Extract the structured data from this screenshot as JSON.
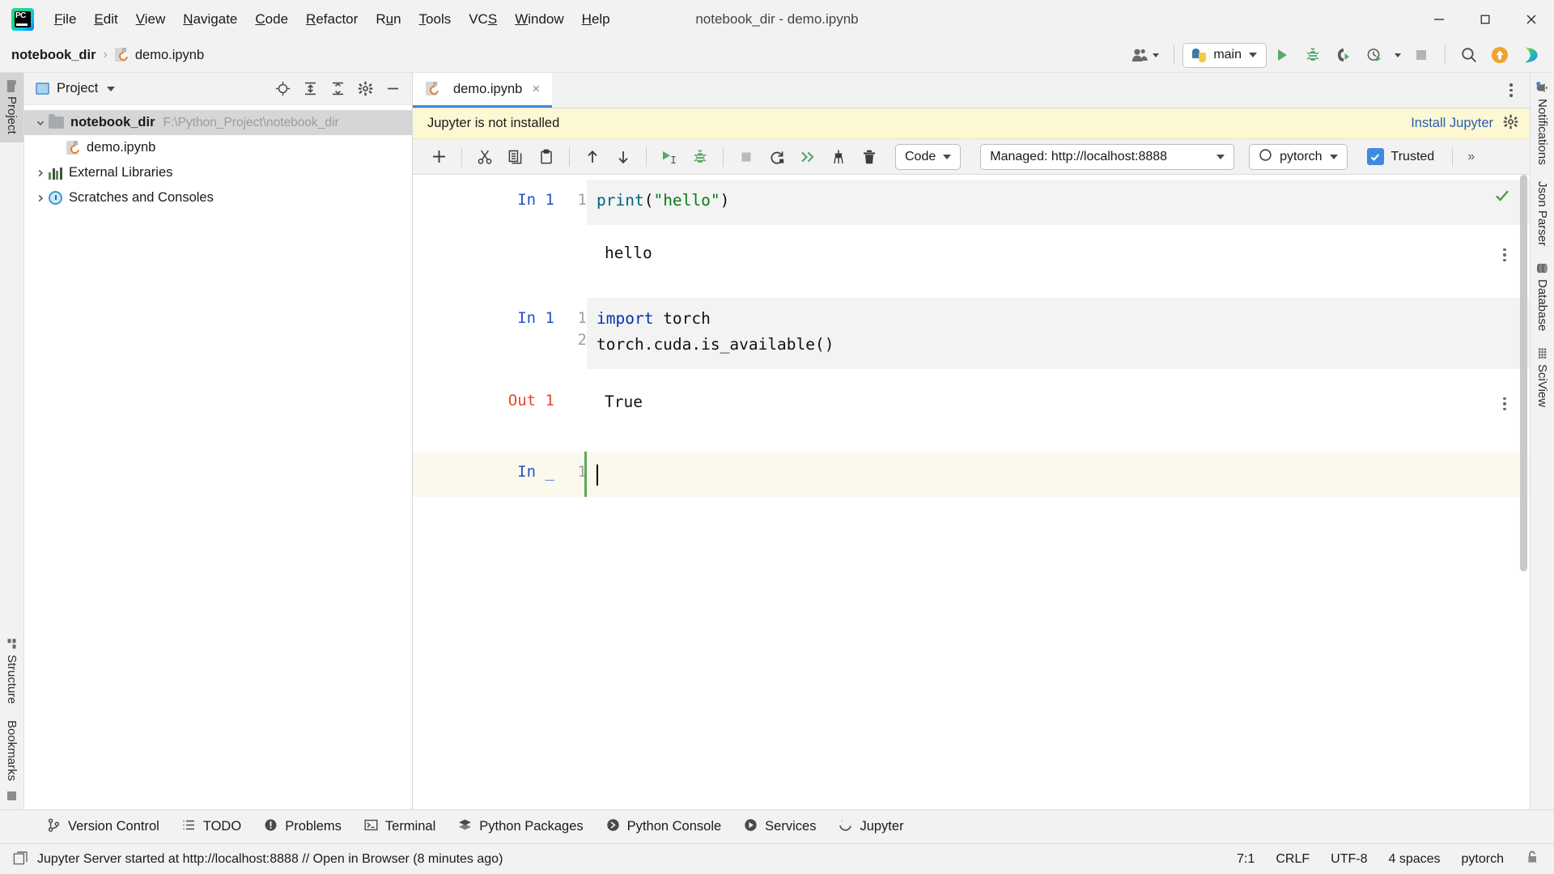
{
  "window": {
    "title": "notebook_dir - demo.ipynb",
    "app_icon": "pycharm-logo-icon",
    "controls": {
      "minimize": "minimize-icon",
      "maximize": "maximize-icon",
      "close": "close-icon"
    }
  },
  "menu": {
    "items": [
      {
        "label": "File",
        "mnemonic": "F"
      },
      {
        "label": "Edit",
        "mnemonic": "E"
      },
      {
        "label": "View",
        "mnemonic": "V"
      },
      {
        "label": "Navigate",
        "mnemonic": "N"
      },
      {
        "label": "Code",
        "mnemonic": "C"
      },
      {
        "label": "Refactor",
        "mnemonic": "R"
      },
      {
        "label": "Run",
        "mnemonic": "u"
      },
      {
        "label": "Tools",
        "mnemonic": "T"
      },
      {
        "label": "VCS",
        "mnemonic": "S"
      },
      {
        "label": "Window",
        "mnemonic": "W"
      },
      {
        "label": "Help",
        "mnemonic": "H"
      }
    ]
  },
  "navbar": {
    "breadcrumb": {
      "project": "notebook_dir",
      "separator": "›",
      "file": "demo.ipynb"
    },
    "account_icon": "user-account-icon",
    "run_config": {
      "label": "main",
      "icon": "python-icon"
    },
    "actions": [
      {
        "name": "run-button",
        "icon": "run-triangle-icon"
      },
      {
        "name": "debug-button",
        "icon": "debug-bug-icon"
      },
      {
        "name": "run-with-coverage-button",
        "icon": "coverage-icon"
      },
      {
        "name": "profile-button",
        "icon": "profiler-clock-icon"
      },
      {
        "name": "stop-button",
        "icon": "stop-square-icon"
      },
      {
        "name": "search-everywhere-button",
        "icon": "search-icon"
      },
      {
        "name": "update-project-button",
        "icon": "update-arrow-icon"
      },
      {
        "name": "ai-assistant-button",
        "icon": "ai-assistant-icon"
      }
    ]
  },
  "left_strip": {
    "top": [
      {
        "label": "Project",
        "icon": "folder-icon",
        "selected": true
      }
    ],
    "bottom": [
      {
        "label": "Structure",
        "icon": "structure-icon",
        "selected": false
      },
      {
        "label": "Bookmarks",
        "icon": "bookmarks-icon",
        "selected": false
      }
    ]
  },
  "right_strip": {
    "items": [
      {
        "label": "Notifications",
        "icon": "bell-icon",
        "badge": true
      },
      {
        "label": "Json Parser",
        "icon": "json-icon",
        "badge": false
      },
      {
        "label": "Database",
        "icon": "database-icon",
        "badge": false
      },
      {
        "label": "SciView",
        "icon": "sciview-grid-icon",
        "badge": false
      }
    ]
  },
  "project_panel": {
    "title": "Project",
    "title_icon": "project-view-icon",
    "actions": [
      {
        "name": "select-opened-file-button",
        "icon": "locate-target-icon"
      },
      {
        "name": "expand-all-button",
        "icon": "expand-all-icon"
      },
      {
        "name": "collapse-all-button",
        "icon": "collapse-all-icon"
      },
      {
        "name": "settings-button",
        "icon": "gear-icon"
      },
      {
        "name": "hide-button",
        "icon": "minimize-panel-icon"
      }
    ],
    "tree": [
      {
        "label": "notebook_dir",
        "path": "F:\\Python_Project\\notebook_dir",
        "icon": "folder-icon",
        "expanded": true,
        "indent": 0,
        "bold": true,
        "selected": true
      },
      {
        "label": "demo.ipynb",
        "path": "",
        "icon": "notebook-file-icon",
        "expanded": null,
        "indent": 1,
        "bold": false,
        "selected": false
      },
      {
        "label": "External Libraries",
        "path": "",
        "icon": "library-icon",
        "expanded": false,
        "indent": 0,
        "bold": false,
        "selected": false
      },
      {
        "label": "Scratches and Consoles",
        "path": "",
        "icon": "scratches-icon",
        "expanded": false,
        "indent": 0,
        "bold": false,
        "selected": false
      }
    ]
  },
  "editor": {
    "tab": {
      "label": "demo.ipynb",
      "icon": "notebook-file-icon",
      "close": "×"
    },
    "more_actions_icon": "vertical-dots-icon",
    "banner": {
      "message": "Jupyter is not installed",
      "action": "Install Jupyter",
      "settings_icon": "gear-icon"
    },
    "notebook_toolbar": {
      "buttons": [
        {
          "name": "add-cell-button",
          "icon": "plus-icon"
        },
        {
          "name": "cut-cell-button",
          "icon": "scissors-icon"
        },
        {
          "name": "copy-cell-button",
          "icon": "copy-icon"
        },
        {
          "name": "paste-cell-button",
          "icon": "paste-icon"
        },
        {
          "name": "move-cell-up-button",
          "icon": "arrow-up-icon"
        },
        {
          "name": "move-cell-down-button",
          "icon": "arrow-down-icon"
        },
        {
          "name": "run-cell-button",
          "icon": "run-cell-icon"
        },
        {
          "name": "debug-cell-button",
          "icon": "debug-bug-icon"
        },
        {
          "name": "interrupt-kernel-button",
          "icon": "stop-square-icon"
        },
        {
          "name": "restart-kernel-button",
          "icon": "restart-icon"
        },
        {
          "name": "run-all-cells-button",
          "icon": "double-chevron-run-icon"
        },
        {
          "name": "clear-outputs-button",
          "icon": "broom-icon"
        },
        {
          "name": "delete-cell-button",
          "icon": "trash-icon"
        }
      ],
      "cell_type": "Code",
      "server": "Managed: http://localhost:8888",
      "kernel": "pytorch",
      "kernel_icon": "kernel-idle-circle-icon",
      "trusted_label": "Trusted",
      "trusted_checked": true,
      "overflow": "»"
    },
    "cells": [
      {
        "prompt": "In 1",
        "type": "code",
        "active": false,
        "lines": [
          {
            "no": "1",
            "tokens": [
              {
                "t": "print",
                "c": "fn"
              },
              {
                "t": "(",
                "c": "plain"
              },
              {
                "t": "\"hello\"",
                "c": "str"
              },
              {
                "t": ")",
                "c": "plain"
              }
            ]
          }
        ],
        "output": {
          "prompt": "",
          "text": "hello",
          "type": "stream"
        }
      },
      {
        "prompt": "In 1",
        "type": "code",
        "active": false,
        "lines": [
          {
            "no": "1",
            "tokens": [
              {
                "t": "import",
                "c": "kw"
              },
              {
                "t": " torch",
                "c": "plain"
              }
            ]
          },
          {
            "no": "2",
            "tokens": [
              {
                "t": "torch.cuda.is_available()",
                "c": "plain"
              }
            ]
          }
        ],
        "output": {
          "prompt": "Out 1",
          "text": "True",
          "type": "result"
        }
      },
      {
        "prompt": "In _",
        "type": "code",
        "active": true,
        "lines": [
          {
            "no": "1",
            "tokens": []
          }
        ],
        "output": null
      }
    ],
    "inspection_ok_icon": "inspection-check-icon"
  },
  "tool_windows": [
    {
      "label": "Version Control",
      "icon": "branch-icon"
    },
    {
      "label": "TODO",
      "icon": "list-icon"
    },
    {
      "label": "Problems",
      "icon": "exclamation-circle-icon"
    },
    {
      "label": "Terminal",
      "icon": "terminal-icon"
    },
    {
      "label": "Python Packages",
      "icon": "packages-icon"
    },
    {
      "label": "Python Console",
      "icon": "python-console-icon"
    },
    {
      "label": "Services",
      "icon": "services-icon"
    },
    {
      "label": "Jupyter",
      "icon": "jupyter-icon"
    }
  ],
  "status_bar": {
    "icon": "console-icon",
    "message": "Jupyter Server started at http://localhost:8888 // Open in Browser (8 minutes ago)",
    "caret_position": "7:1",
    "line_separator": "CRLF",
    "encoding": "UTF-8",
    "indent": "4 spaces",
    "interpreter": "pytorch",
    "lock_icon": "unlocked-padlock-icon"
  },
  "colors": {
    "accent_blue": "#3c8cd9",
    "banner_yellow": "#fdf8d4",
    "active_cell": "#fbf9ee",
    "prompt_in": "#2850c8",
    "prompt_out": "#e1482a",
    "string_green": "#067d17",
    "keyword_blue": "#0033b3",
    "run_green": "#59a869"
  }
}
